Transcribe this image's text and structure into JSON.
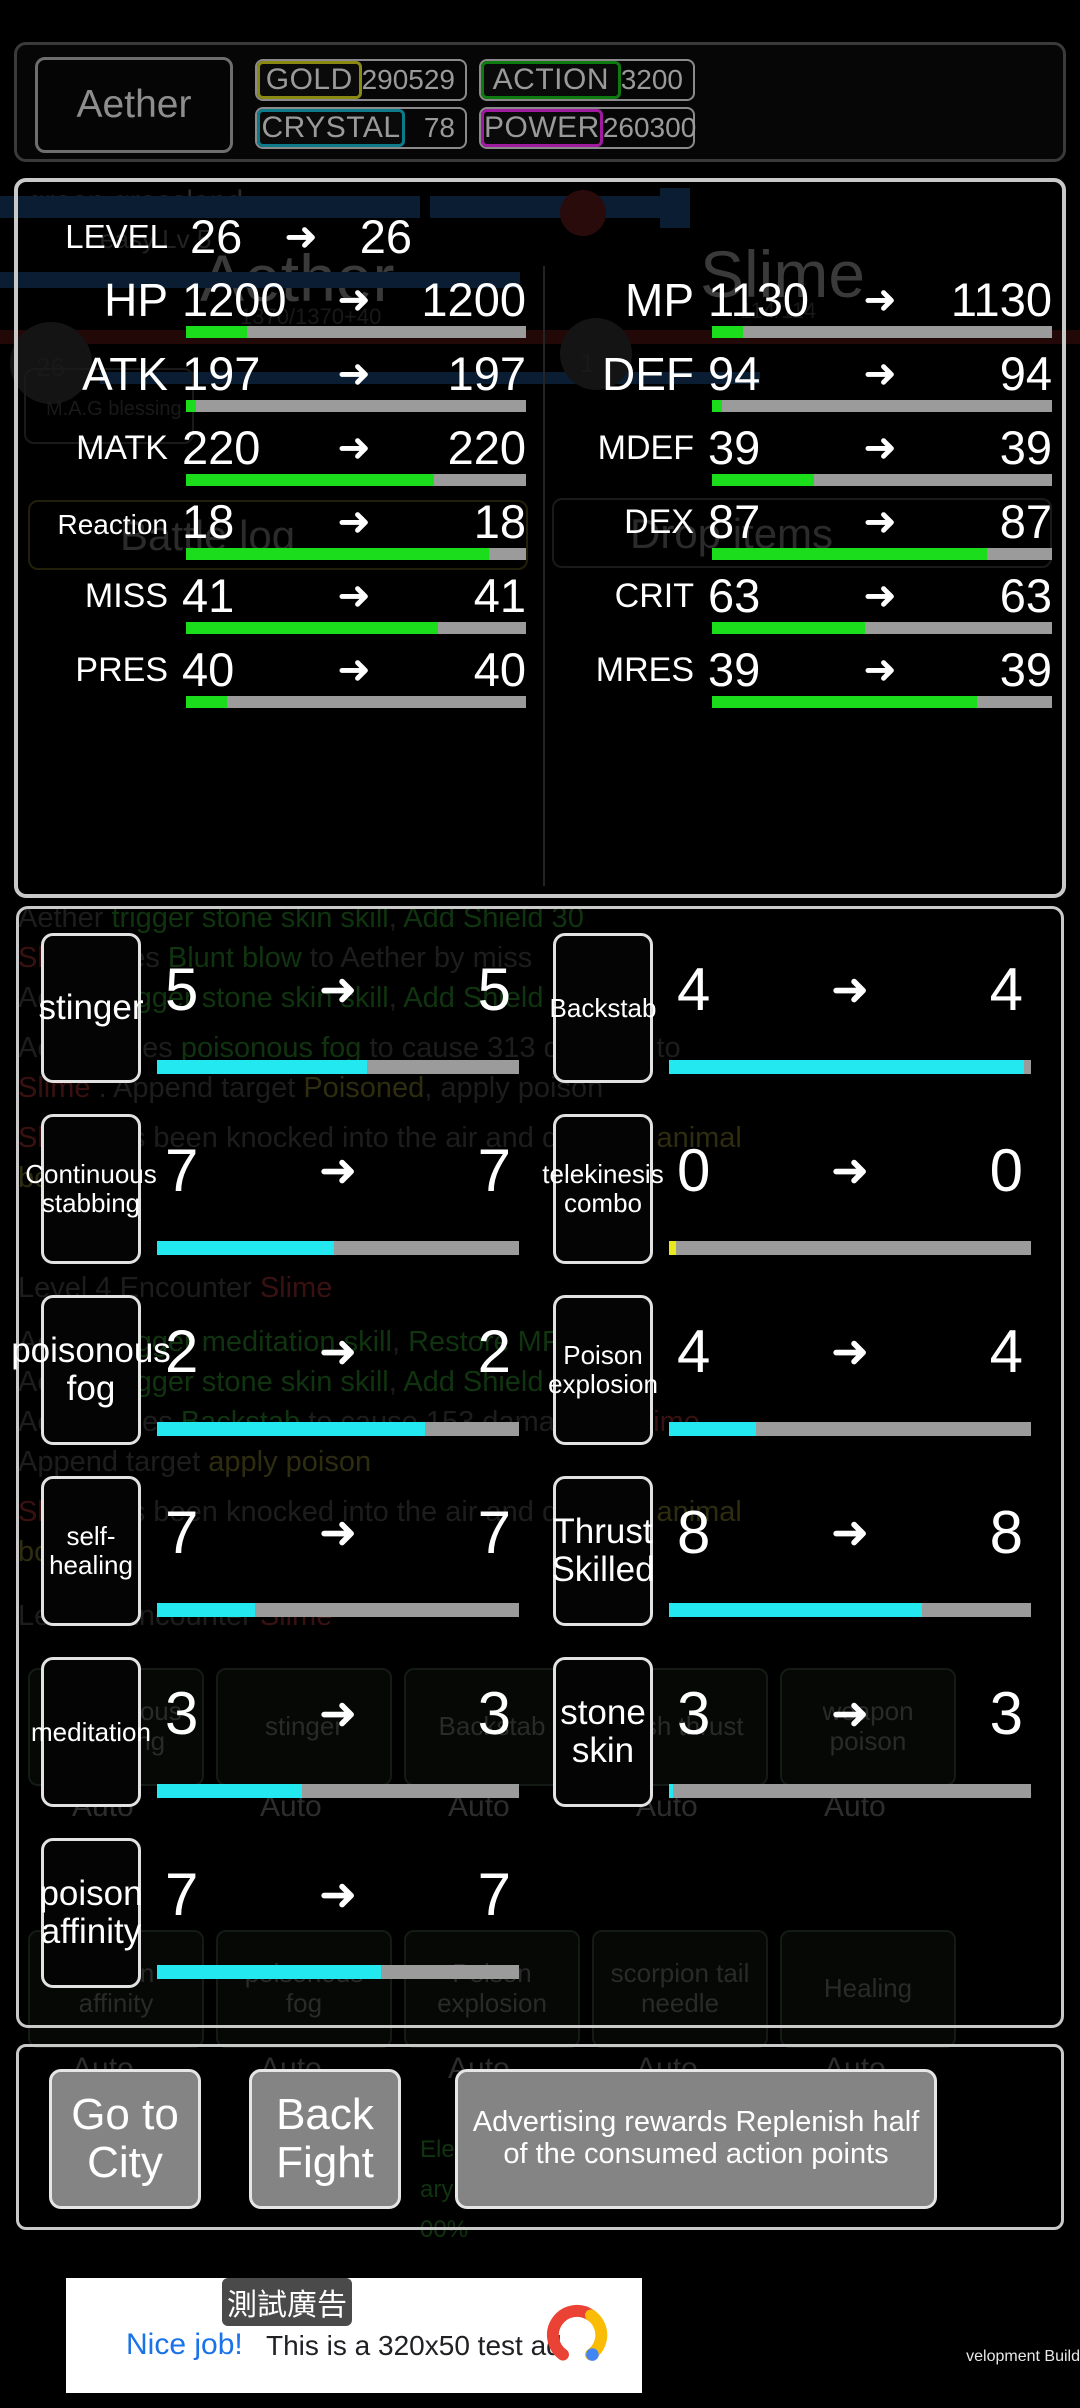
{
  "header": {
    "hero_name": "Aether",
    "resources": [
      {
        "label": "GOLD",
        "value": "290529",
        "color": "#8a8a12"
      },
      {
        "label": "ACTION",
        "value": "3200",
        "color": "#0f7a0f"
      },
      {
        "label": "CRYSTAL",
        "value": "78",
        "color": "#0d7a8a"
      },
      {
        "label": "POWER",
        "value": "260300",
        "color": "#a01aa0"
      }
    ]
  },
  "stats": {
    "level": {
      "label": "LEVEL",
      "from": "26",
      "to": "26"
    },
    "arrow": "➜",
    "left": [
      {
        "label": "HP",
        "from": "1200",
        "to": "1200",
        "fill": 18,
        "size": "lg"
      },
      {
        "label": "ATK",
        "from": "197",
        "to": "197",
        "fill": 3,
        "size": "lg"
      },
      {
        "label": "MATK",
        "from": "220",
        "to": "220",
        "fill": 73,
        "size": "md"
      },
      {
        "label": "Reaction",
        "from": "18",
        "to": "18",
        "fill": 89,
        "size": "sm"
      },
      {
        "label": "MISS",
        "from": "41",
        "to": "41",
        "fill": 74,
        "size": "md"
      },
      {
        "label": "PRES",
        "from": "40",
        "to": "40",
        "fill": 12,
        "size": "md"
      }
    ],
    "right": [
      {
        "label": "MP",
        "from": "1130",
        "to": "1130",
        "fill": 9,
        "size": "lg"
      },
      {
        "label": "DEF",
        "from": "94",
        "to": "94",
        "fill": 3,
        "size": "lg"
      },
      {
        "label": "MDEF",
        "from": "39",
        "to": "39",
        "fill": 30,
        "size": "md"
      },
      {
        "label": "DEX",
        "from": "87",
        "to": "87",
        "fill": 81,
        "size": "md"
      },
      {
        "label": "CRIT",
        "from": "63",
        "to": "63",
        "fill": 45,
        "size": "md"
      },
      {
        "label": "MRES",
        "from": "39",
        "to": "39",
        "fill": 78,
        "size": "md"
      }
    ]
  },
  "skills": {
    "arrow": "➜",
    "items": [
      {
        "name": "stinger",
        "from": "5",
        "to": "5",
        "fill": 58,
        "bar": "cyan",
        "big": true
      },
      {
        "name": "Backstab",
        "from": "4",
        "to": "4",
        "fill": 98,
        "bar": "cyan",
        "big": false
      },
      {
        "name": "Continuous stabbing",
        "from": "7",
        "to": "7",
        "fill": 49,
        "bar": "cyan",
        "big": false
      },
      {
        "name": "telekinesis combo",
        "from": "0",
        "to": "0",
        "fill": 2,
        "bar": "yellow",
        "big": false
      },
      {
        "name": "poisonous fog",
        "from": "2",
        "to": "2",
        "fill": 74,
        "bar": "cyan",
        "big": true
      },
      {
        "name": "Poison explosion",
        "from": "4",
        "to": "4",
        "fill": 24,
        "bar": "cyan",
        "big": false
      },
      {
        "name": "self-healing",
        "from": "7",
        "to": "7",
        "fill": 27,
        "bar": "cyan",
        "big": false
      },
      {
        "name": "Thrust Skilled",
        "from": "8",
        "to": "8",
        "fill": 70,
        "bar": "cyan",
        "big": true
      },
      {
        "name": "meditation",
        "from": "3",
        "to": "3",
        "fill": 40,
        "bar": "cyan",
        "big": false
      },
      {
        "name": "stone skin",
        "from": "3",
        "to": "3",
        "fill": 1,
        "bar": "cyan",
        "big": true
      },
      {
        "name": "poison affinity",
        "from": "7",
        "to": "7",
        "fill": 62,
        "bar": "cyan",
        "big": true
      }
    ]
  },
  "footer": {
    "go_to_city": "Go to City",
    "back_fight": "Back Fight",
    "ad_reward": "Advertising rewards Replenish half of the consumed action points"
  },
  "ad": {
    "badge": "測試廣告",
    "headline": "Nice job!",
    "body": "This is a 320x50 test ad.",
    "dev_build": "velopment Build"
  },
  "background": {
    "map_title": "green grassland",
    "map_sub": "easy Lv 5",
    "hero_ghost": "Aether",
    "enemy_ghost": "Slime",
    "hp_ghost": "1370/1370+40",
    "mp_ghost": "114/114",
    "panel_battle_log": "Battle log",
    "panel_drop_items": "Drop items",
    "blessing": "M.A.G blessing",
    "level_badge_left": "26",
    "level_badge_right": "1",
    "log_lines": [
      "Aether  trigger stone skin skill, Add Shield 30",
      "Slime  uses Blunt blow to Aether  by miss",
      "Aether  trigger stone skin skill, Add Shield 30",
      "Aether  uses poisonous fog to cause 313 damage to",
      "Slime . Append target Poisoned, apply poison",
      "Slime  has been knocked into the air and dropped animal",
      "bones",
      "Level 4 Encounter Slime",
      "Aether  trigger meditation skill, Restore MP 60",
      "Aether  trigger stone skin skill, Add Shield 30",
      "Aether  uses Backstab to cause 153 damage to Slime .",
      "Append target apply poison",
      "Slime  has been knocked into the air and dropped animal",
      "bones",
      "Level 5 Encounter Slime"
    ],
    "skill_buttons": [
      "Continuous stabbing",
      "stinger",
      "Backstab",
      "flash thrust",
      "weapon poison",
      "poison affinity",
      "poisonous fog",
      "Poison explosion",
      "scorpion tail needle",
      "Healing"
    ],
    "auto_label": "Auto"
  }
}
